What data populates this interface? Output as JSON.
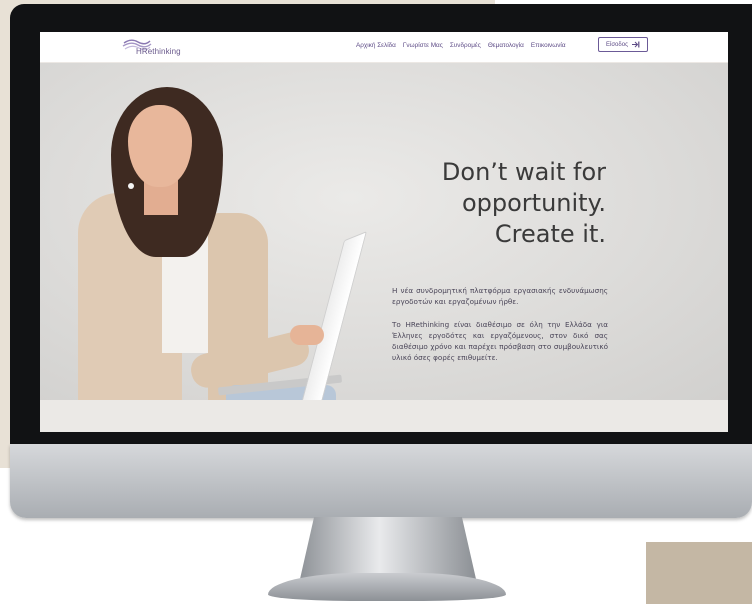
{
  "logo": {
    "text": "HRethinking"
  },
  "nav": {
    "items": [
      "Αρχική Σελίδα",
      "Γνωρίστε Μας",
      "Συνδρομές",
      "Θεματολογία",
      "Επικοινωνία"
    ],
    "login_label": "Είσοδος",
    "login_icon": "login-arrow-icon"
  },
  "hero": {
    "headline_lines": [
      "Don’t wait for",
      "opportunity.",
      "Create it."
    ],
    "paragraph1": "Η νέα συνδρομητική πλατφόρμα εργασιακής ενδυνάμωσης εργοδοτών και εργαζομένων ήρθε.",
    "paragraph2": "Το HRethinking είναι διαθέσιμο σε όλη την Ελλάδα για Έλληνες εργοδότες και εργαζόμενους, στον δικό σας διαθέσιμο χρόνο και παρέχει πρόσβαση στο συμβουλευτικό υλικό όσες φορές επιθυμείτε."
  },
  "colors": {
    "brand_purple": "#5d4b86",
    "hero_bg": "#dddcda",
    "deco_beige": "#e8e1d6",
    "deco_taupe": "#c4b7a4"
  }
}
